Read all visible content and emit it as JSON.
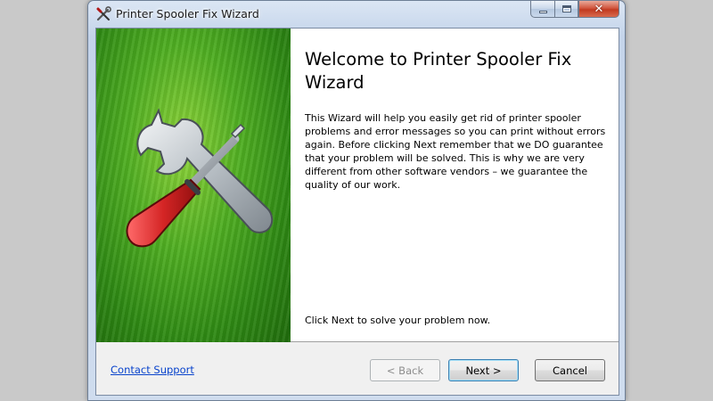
{
  "window": {
    "title": "Printer Spooler Fix Wizard",
    "icon": "tools-icon"
  },
  "caption_buttons": {
    "minimize_icon": "minimize-icon",
    "maximize_icon": "maximize-icon",
    "close_icon": "close-icon",
    "close_glyph": "✕"
  },
  "banner": {
    "image": "wrench-screwdriver-illustration",
    "colors": {
      "background": "#4fae22",
      "handle": "#cc1f1f",
      "metal": "#c9ced3"
    }
  },
  "content": {
    "heading": "Welcome to Printer Spooler Fix Wizard",
    "body": "This Wizard will help you easily get rid of printer spooler problems and error messages so you can print without errors again. Before clicking Next remember that we DO guarantee that your problem will be solved. This is why we are very different from other software vendors – we guarantee the quality of our work.",
    "footer": "Click Next to solve your problem now."
  },
  "footer_bar": {
    "support_link": "Contact Support",
    "back_button": "< Back",
    "back_enabled": false,
    "next_button": "Next >",
    "cancel_button": "Cancel"
  }
}
